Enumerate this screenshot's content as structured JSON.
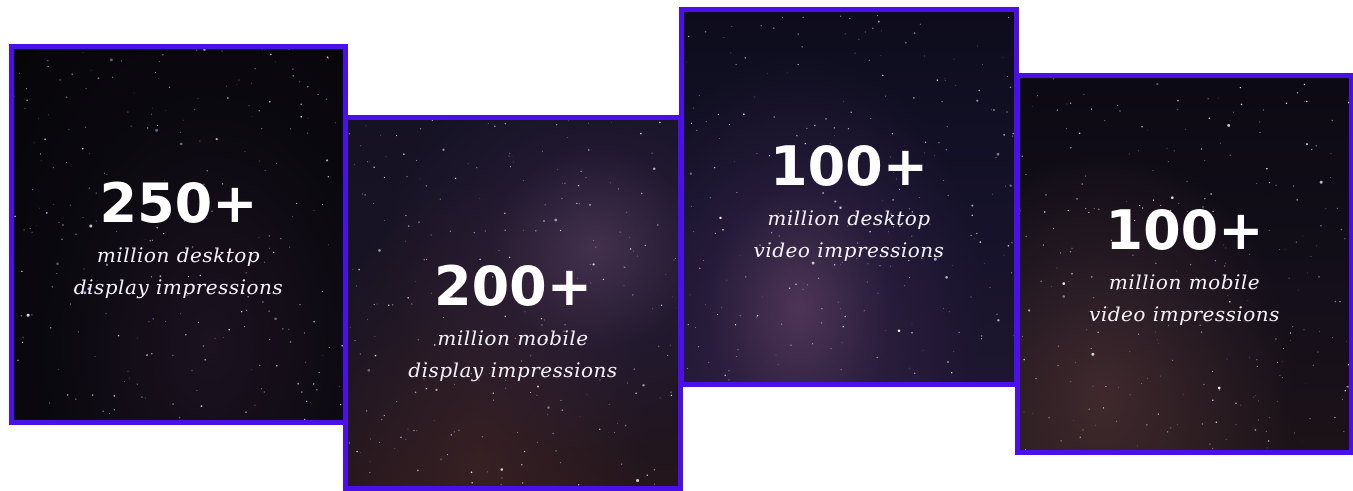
{
  "border_color": "#4b0fe8",
  "stats": [
    {
      "number": "250+",
      "line1": "million desktop",
      "line2": "display impressions"
    },
    {
      "number": "200+",
      "line1": "million mobile",
      "line2": "display impressions"
    },
    {
      "number": "100+",
      "line1": "million desktop",
      "line2": "video impressions"
    },
    {
      "number": "100+",
      "line1": "million mobile",
      "line2": "video impressions"
    }
  ]
}
